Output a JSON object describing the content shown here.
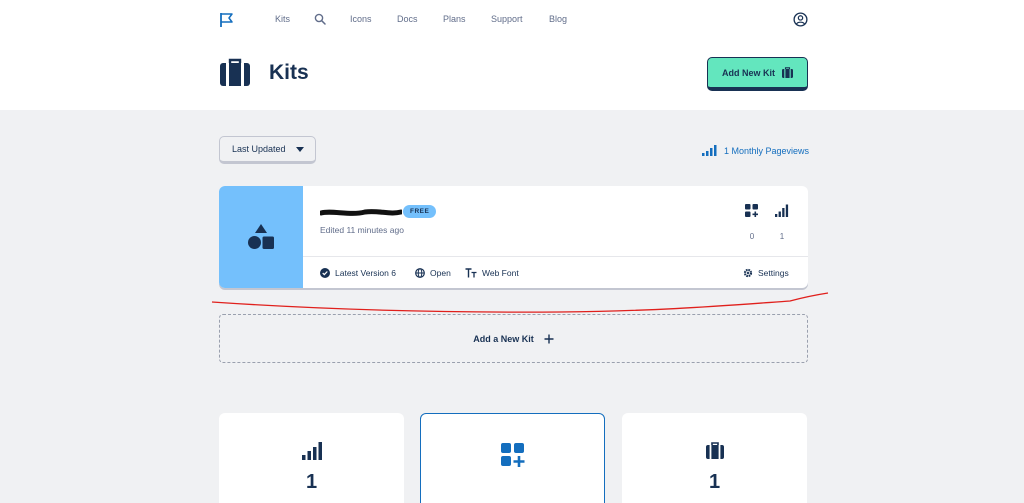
{
  "nav": {
    "links": [
      "Kits",
      "Icons",
      "Docs",
      "Plans",
      "Support",
      "Blog"
    ]
  },
  "header": {
    "title": "Kits",
    "add_button_label": "Add New Kit"
  },
  "toolbar": {
    "sort_label": "Last Updated",
    "pageviews_label": "1 Monthly Pageviews"
  },
  "kit": {
    "badge": "FREE",
    "edited": "Edited 11 minutes ago",
    "icons_count": "0",
    "pageviews_count": "1",
    "actions": {
      "version": "Latest Version 6",
      "open": "Open",
      "technology": "Web Font",
      "settings": "Settings"
    },
    "thumbnail_color": "#74c0fc"
  },
  "add_new_kit_label": "Add a New Kit",
  "stats": {
    "pageviews_value": "1",
    "kits_value": "1"
  },
  "colors": {
    "accent": "#63e6be",
    "navy": "#183153",
    "link_blue": "#146ebe",
    "light_blue": "#74c0fc"
  }
}
